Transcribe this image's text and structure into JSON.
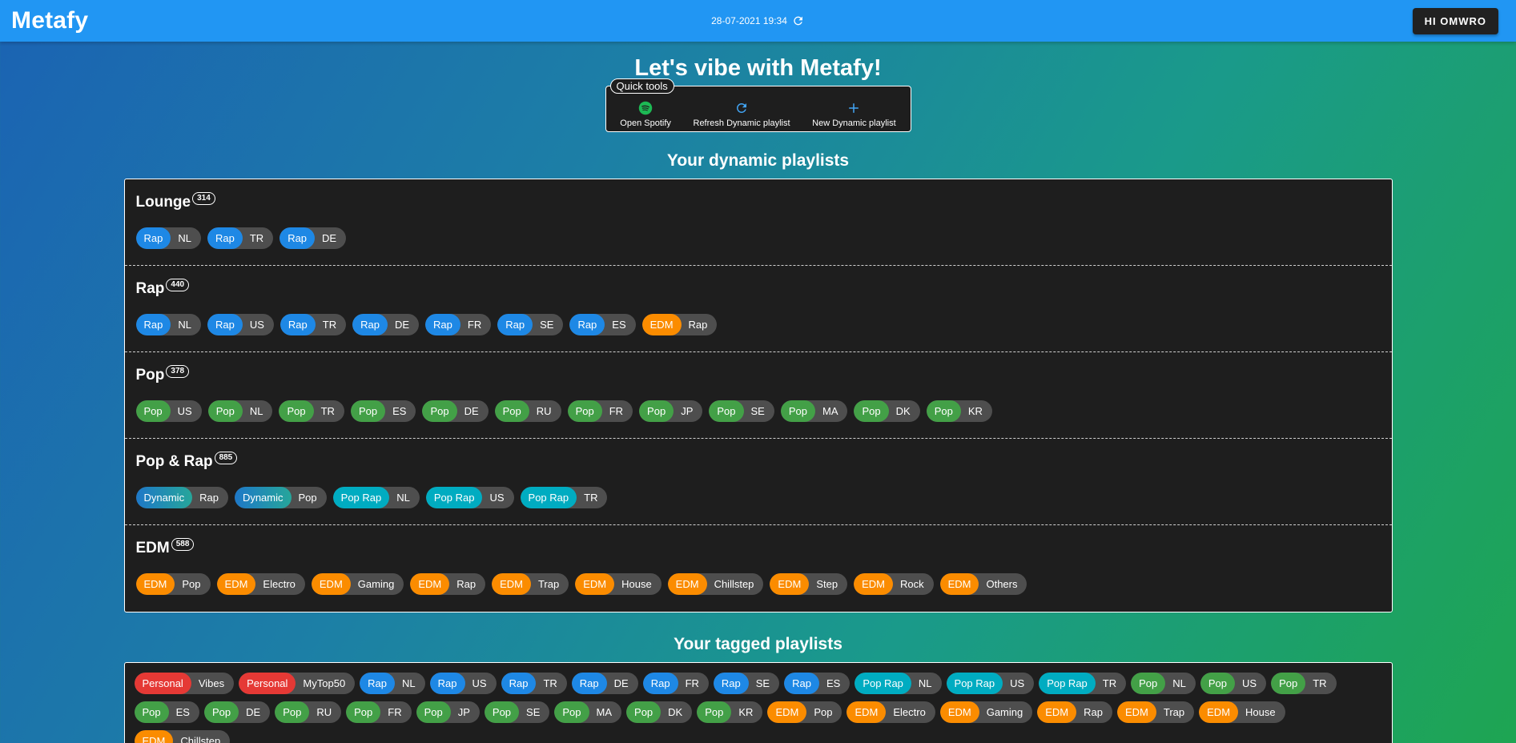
{
  "header": {
    "brand": "Metafy",
    "datetime": "28-07-2021 19:34",
    "user_button": "HI OMWRO"
  },
  "colors": {
    "Rap": "#1e88e5",
    "Pop": "#43a047",
    "EDM": "#fb8c00",
    "Pop Rap": "#00acc1",
    "Dynamic": "#2a8fa0",
    "Personal": "#e53935"
  },
  "hero": {
    "title": "Let's vibe with Metafy!"
  },
  "quick_tools": {
    "legend": "Quick tools",
    "items": [
      {
        "label": "Open Spotify",
        "icon": "spotify-icon"
      },
      {
        "label": "Refresh Dynamic playlist",
        "icon": "refresh-icon"
      },
      {
        "label": "New Dynamic playlist",
        "icon": "plus-icon"
      }
    ]
  },
  "dynamic_section": {
    "title": "Your dynamic playlists",
    "playlists": [
      {
        "name": "Lounge",
        "count": "314",
        "tags": [
          [
            "Rap",
            "NL"
          ],
          [
            "Rap",
            "TR"
          ],
          [
            "Rap",
            "DE"
          ]
        ]
      },
      {
        "name": "Rap",
        "count": "440",
        "tags": [
          [
            "Rap",
            "NL"
          ],
          [
            "Rap",
            "US"
          ],
          [
            "Rap",
            "TR"
          ],
          [
            "Rap",
            "DE"
          ],
          [
            "Rap",
            "FR"
          ],
          [
            "Rap",
            "SE"
          ],
          [
            "Rap",
            "ES"
          ],
          [
            "EDM",
            "Rap"
          ]
        ]
      },
      {
        "name": "Pop",
        "count": "378",
        "tags": [
          [
            "Pop",
            "US"
          ],
          [
            "Pop",
            "NL"
          ],
          [
            "Pop",
            "TR"
          ],
          [
            "Pop",
            "ES"
          ],
          [
            "Pop",
            "DE"
          ],
          [
            "Pop",
            "RU"
          ],
          [
            "Pop",
            "FR"
          ],
          [
            "Pop",
            "JP"
          ],
          [
            "Pop",
            "SE"
          ],
          [
            "Pop",
            "MA"
          ],
          [
            "Pop",
            "DK"
          ],
          [
            "Pop",
            "KR"
          ]
        ]
      },
      {
        "name": "Pop & Rap",
        "count": "885",
        "tags": [
          [
            "Dynamic",
            "Rap"
          ],
          [
            "Dynamic",
            "Pop"
          ],
          [
            "Pop Rap",
            "NL"
          ],
          [
            "Pop Rap",
            "US"
          ],
          [
            "Pop Rap",
            "TR"
          ]
        ]
      },
      {
        "name": "EDM",
        "count": "588",
        "tags": [
          [
            "EDM",
            "Pop"
          ],
          [
            "EDM",
            "Electro"
          ],
          [
            "EDM",
            "Gaming"
          ],
          [
            "EDM",
            "Rap"
          ],
          [
            "EDM",
            "Trap"
          ],
          [
            "EDM",
            "House"
          ],
          [
            "EDM",
            "Chillstep"
          ],
          [
            "EDM",
            "Step"
          ],
          [
            "EDM",
            "Rock"
          ],
          [
            "EDM",
            "Others"
          ]
        ]
      }
    ]
  },
  "tagged_section": {
    "title": "Your tagged playlists",
    "tags": [
      [
        "Personal",
        "Vibes"
      ],
      [
        "Personal",
        "MyTop50"
      ],
      [
        "Rap",
        "NL"
      ],
      [
        "Rap",
        "US"
      ],
      [
        "Rap",
        "TR"
      ],
      [
        "Rap",
        "DE"
      ],
      [
        "Rap",
        "FR"
      ],
      [
        "Rap",
        "SE"
      ],
      [
        "Rap",
        "ES"
      ],
      [
        "Pop Rap",
        "NL"
      ],
      [
        "Pop Rap",
        "US"
      ],
      [
        "Pop Rap",
        "TR"
      ],
      [
        "Pop",
        "NL"
      ],
      [
        "Pop",
        "US"
      ],
      [
        "Pop",
        "TR"
      ],
      [
        "Pop",
        "ES"
      ],
      [
        "Pop",
        "DE"
      ],
      [
        "Pop",
        "RU"
      ],
      [
        "Pop",
        "FR"
      ],
      [
        "Pop",
        "JP"
      ],
      [
        "Pop",
        "SE"
      ],
      [
        "Pop",
        "MA"
      ],
      [
        "Pop",
        "DK"
      ],
      [
        "Pop",
        "KR"
      ],
      [
        "EDM",
        "Pop"
      ],
      [
        "EDM",
        "Electro"
      ],
      [
        "EDM",
        "Gaming"
      ],
      [
        "EDM",
        "Rap"
      ],
      [
        "EDM",
        "Trap"
      ],
      [
        "EDM",
        "House"
      ],
      [
        "EDM",
        "Chillstep"
      ]
    ]
  }
}
